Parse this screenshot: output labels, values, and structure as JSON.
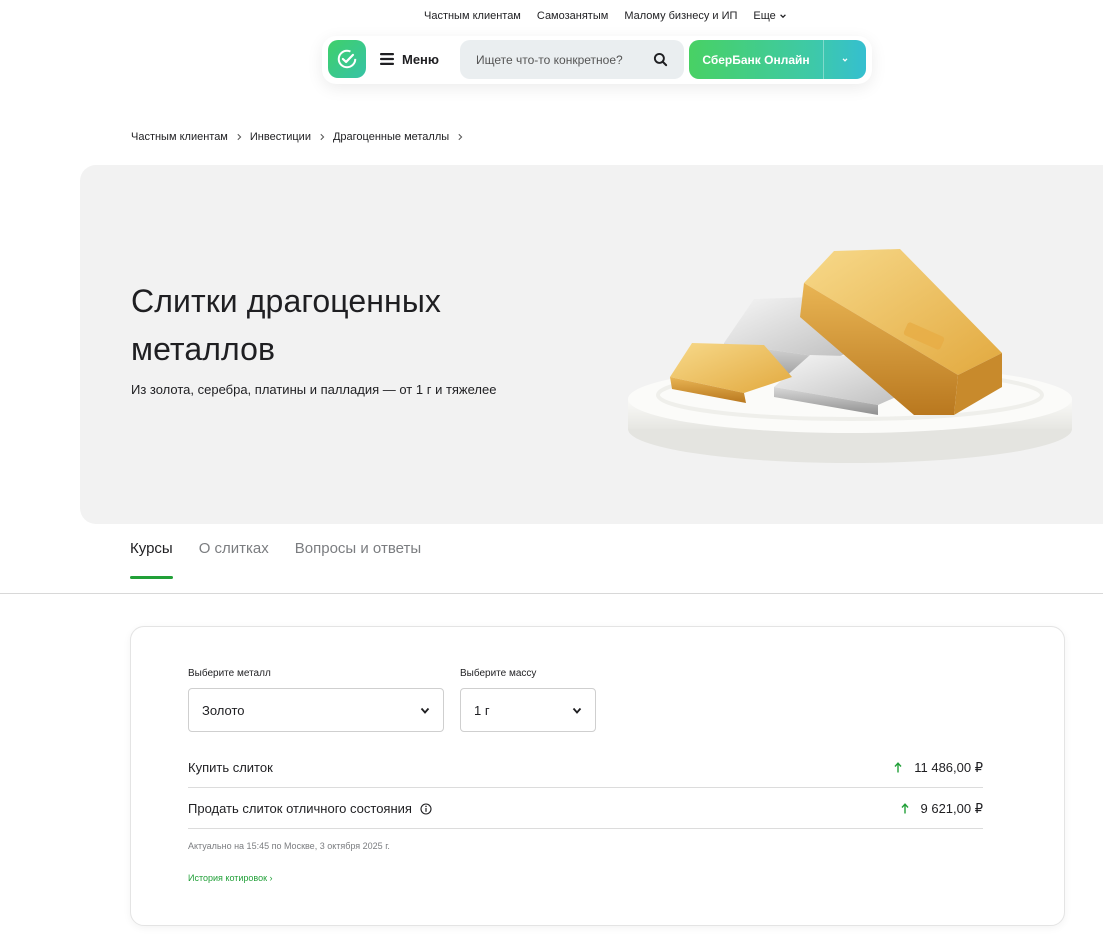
{
  "top_links": [
    "Частным клиентам",
    "Самозанятым",
    "Малому бизнесу и ИП",
    "Еще"
  ],
  "header": {
    "menu_label": "Меню",
    "search_placeholder": "Ищете что-то конкретное?",
    "online_label": "СберБанк Онлайн"
  },
  "breadcrumb": [
    "Частным клиентам",
    "Инвестиции",
    "Драгоценные металлы"
  ],
  "hero": {
    "title": "Слитки драгоценных металлов",
    "subtitle": "Из золота, серебра, платины и палладия — от 1 г и тяжелее"
  },
  "tabs": [
    "Курсы",
    "О слитках",
    "Вопросы и ответы"
  ],
  "calculator": {
    "metal_label": "Выберите металл",
    "metal_value": "Золото",
    "mass_label": "Выберите массу",
    "mass_value": "1 г",
    "buy_label": "Купить слиток",
    "buy_price": "11 486,00 ₽",
    "sell_label": "Продать слиток отличного состояния",
    "sell_price": "9 621,00 ₽",
    "updated": "Актуально на 15:45 по Москве, 3 октября 2025 г.",
    "history_link": "История котировок ›"
  },
  "colors": {
    "brand_green": "#21a038",
    "hero_bg": "#f2f2f2"
  },
  "icons": [
    "sber-logo-icon",
    "menu-icon",
    "search-icon",
    "chevron-down-icon",
    "chevron-right-icon",
    "info-icon",
    "arrow-up-icon"
  ]
}
